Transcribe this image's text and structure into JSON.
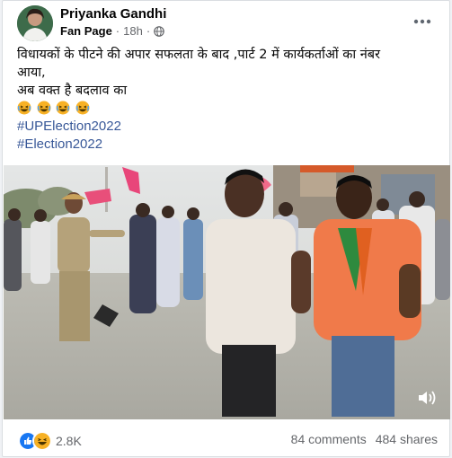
{
  "post": {
    "author": "Priyanka Gandhi",
    "page_label": "Fan Page",
    "time": "18h",
    "text_line1": "विधायकों के पीटने की अपार सफलता के बाद ,पार्ट 2 में कार्यकर्ताओं का नंबर",
    "text_line2": "आया,",
    "text_line3": "अब वक्त है बदलाव का",
    "hashtags": [
      "#UPElection2022",
      "#Election2022"
    ]
  },
  "reactions": {
    "count": "2.8K",
    "comments": "84 comments",
    "shares": "484 shares"
  },
  "colors": {
    "link": "#385898",
    "like": "#1877f2",
    "haha": "#f7b125"
  }
}
